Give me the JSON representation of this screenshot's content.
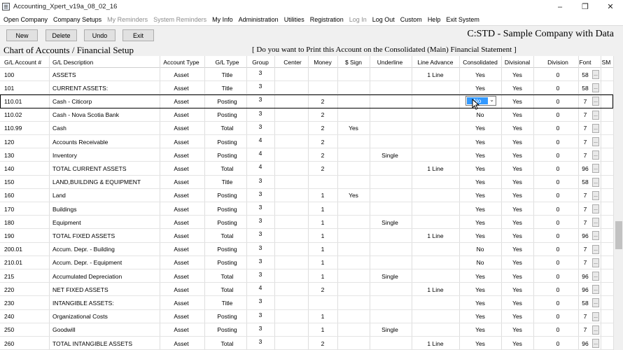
{
  "window": {
    "title": "Accounting_Xpert_v19a_08_02_16",
    "controls": [
      "–",
      "❐",
      "✕"
    ]
  },
  "menu": [
    {
      "label": "Open Company",
      "disabled": false
    },
    {
      "label": "Company Setups",
      "disabled": false
    },
    {
      "label": "My Reminders",
      "disabled": true
    },
    {
      "label": "System Reminders",
      "disabled": true
    },
    {
      "label": "My Info",
      "disabled": false
    },
    {
      "label": "Administration",
      "disabled": false
    },
    {
      "label": "Utilities",
      "disabled": false
    },
    {
      "label": "Registration",
      "disabled": false
    },
    {
      "label": "Log In",
      "disabled": true
    },
    {
      "label": "Log Out",
      "disabled": false
    },
    {
      "label": "Custom",
      "disabled": false
    },
    {
      "label": "Help",
      "disabled": false
    },
    {
      "label": "Exit System",
      "disabled": false
    }
  ],
  "toolbar": {
    "new": "New",
    "delete": "Delete",
    "undo": "Undo",
    "exit": "Exit",
    "company": "C:STD - Sample Company with Data"
  },
  "section": {
    "title": "Chart of Accounts / Financial Setup",
    "prompt": "[ Do you want to Print this Account on the Consolidated (Main) Financial Statement ]"
  },
  "columns": [
    "G/L Account #",
    "G/L Description",
    "Account Type",
    "G/L Type",
    "Group",
    "Center",
    "Money",
    "$ Sign",
    "Underline",
    "Line Advance",
    "Consolidated",
    "Divisional",
    "Division",
    "Font",
    "SM"
  ],
  "selected_row": 2,
  "combo_value": "No",
  "rows": [
    [
      "100",
      "ASSETS",
      "Asset",
      "Title",
      "3",
      "",
      "",
      "",
      "",
      "1 Line",
      "Yes",
      "Yes",
      "0",
      "58"
    ],
    [
      "101",
      "CURRENT ASSETS:",
      "Asset",
      "Title",
      "3",
      "",
      "",
      "",
      "",
      "",
      "Yes",
      "Yes",
      "0",
      "58"
    ],
    [
      "110.01",
      "Cash - Citicorp",
      "Asset",
      "Posting",
      "3",
      "",
      "2",
      "",
      "",
      "",
      "No",
      "Yes",
      "0",
      "7"
    ],
    [
      "110.02",
      "Cash - Nova Scotia Bank",
      "Asset",
      "Posting",
      "3",
      "",
      "2",
      "",
      "",
      "",
      "No",
      "Yes",
      "0",
      "7"
    ],
    [
      "110.99",
      "Cash",
      "Asset",
      "Total",
      "3",
      "",
      "2",
      "Yes",
      "",
      "",
      "Yes",
      "Yes",
      "0",
      "7"
    ],
    [
      "120",
      "Accounts Receivable",
      "Asset",
      "Posting",
      "4",
      "",
      "2",
      "",
      "",
      "",
      "Yes",
      "Yes",
      "0",
      "7"
    ],
    [
      "130",
      "Inventory",
      "Asset",
      "Posting",
      "4",
      "",
      "2",
      "",
      "Single",
      "",
      "Yes",
      "Yes",
      "0",
      "7"
    ],
    [
      "140",
      "TOTAL CURRENT ASSETS",
      "Asset",
      "Total",
      "4",
      "",
      "2",
      "",
      "",
      "1 Line",
      "Yes",
      "Yes",
      "0",
      "96"
    ],
    [
      "150",
      "LAND,BUILDING & EQUIPMENT",
      "Asset",
      "Title",
      "3",
      "",
      "",
      "",
      "",
      "",
      "Yes",
      "Yes",
      "0",
      "58"
    ],
    [
      "160",
      "Land",
      "Asset",
      "Posting",
      "3",
      "",
      "1",
      "Yes",
      "",
      "",
      "Yes",
      "Yes",
      "0",
      "7"
    ],
    [
      "170",
      "Buildings",
      "Asset",
      "Posting",
      "3",
      "",
      "1",
      "",
      "",
      "",
      "Yes",
      "Yes",
      "0",
      "7"
    ],
    [
      "180",
      "Equipment",
      "Asset",
      "Posting",
      "3",
      "",
      "1",
      "",
      "Single",
      "",
      "Yes",
      "Yes",
      "0",
      "7"
    ],
    [
      "190",
      "TOTAL FIXED ASSETS",
      "Asset",
      "Total",
      "3",
      "",
      "1",
      "",
      "",
      "1 Line",
      "Yes",
      "Yes",
      "0",
      "96"
    ],
    [
      "200.01",
      "Accum. Depr. - Building",
      "Asset",
      "Posting",
      "3",
      "",
      "1",
      "",
      "",
      "",
      "No",
      "Yes",
      "0",
      "7"
    ],
    [
      "210.01",
      "Accum. Depr. - Equipment",
      "Asset",
      "Posting",
      "3",
      "",
      "1",
      "",
      "",
      "",
      "No",
      "Yes",
      "0",
      "7"
    ],
    [
      "215",
      "Accumulated Depreciation",
      "Asset",
      "Total",
      "3",
      "",
      "1",
      "",
      "Single",
      "",
      "Yes",
      "Yes",
      "0",
      "96"
    ],
    [
      "220",
      "NET FIXED ASSETS",
      "Asset",
      "Total",
      "4",
      "",
      "2",
      "",
      "",
      "1 Line",
      "Yes",
      "Yes",
      "0",
      "96"
    ],
    [
      "230",
      "INTANGIBLE ASSETS:",
      "Asset",
      "Title",
      "3",
      "",
      "",
      "",
      "",
      "",
      "Yes",
      "Yes",
      "0",
      "58"
    ],
    [
      "240",
      "Organizational Costs",
      "Asset",
      "Posting",
      "3",
      "",
      "1",
      "",
      "",
      "",
      "Yes",
      "Yes",
      "0",
      "7"
    ],
    [
      "250",
      "Goodwill",
      "Asset",
      "Posting",
      "3",
      "",
      "1",
      "",
      "Single",
      "",
      "Yes",
      "Yes",
      "0",
      "7"
    ],
    [
      "260",
      "TOTAL INTANGIBLE ASSETS",
      "Asset",
      "Total",
      "3",
      "",
      "2",
      "",
      "",
      "1 Line",
      "Yes",
      "Yes",
      "0",
      "96"
    ]
  ],
  "font_button_label": "...",
  "scrollbar": {
    "position": 0.6
  }
}
